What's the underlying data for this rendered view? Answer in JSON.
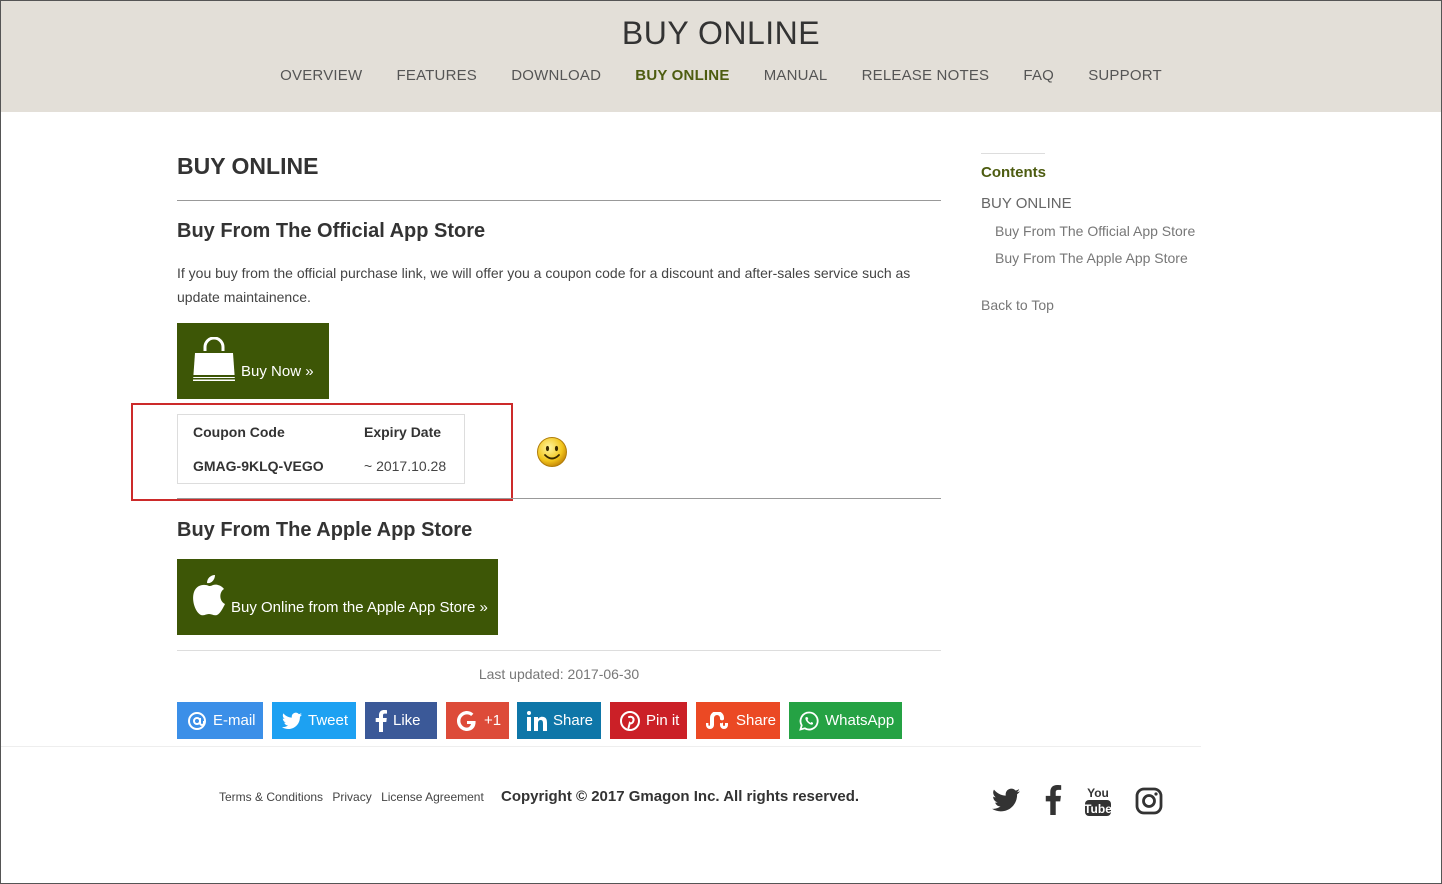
{
  "header": {
    "site_title": "BUY ONLINE",
    "nav": [
      "OVERVIEW",
      "FEATURES",
      "DOWNLOAD",
      "BUY ONLINE",
      "MANUAL",
      "RELEASE NOTES",
      "FAQ",
      "SUPPORT"
    ],
    "active": "BUY ONLINE"
  },
  "main": {
    "page_title": "BUY ONLINE",
    "section1_title": "Buy From The Official App Store",
    "section1_text": "If you buy from the official purchase link, we will offer you a coupon code for a discount and after-sales service such as update maintainence.",
    "buy_now_label": "Buy Now »",
    "coupon": {
      "col1_header": "Coupon Code",
      "col2_header": "Expiry Date",
      "code": "GMAG-9KLQ-VEGO",
      "expiry": "~ 2017.10.28"
    },
    "section2_title": "Buy From The Apple App Store",
    "apple_button_label": "Buy Online from the Apple App Store »",
    "last_updated": "Last updated: 2017-06-30"
  },
  "share": [
    {
      "label": "E-mail",
      "icon": "at-icon",
      "color": "#3b8fe8"
    },
    {
      "label": "Tweet",
      "icon": "twitter-icon",
      "color": "#1da1f2"
    },
    {
      "label": "Like",
      "icon": "facebook-icon",
      "color": "#3b5998"
    },
    {
      "label": "+1",
      "icon": "google-plus-icon",
      "color": "#dd4b39"
    },
    {
      "label": "Share",
      "icon": "linkedin-icon",
      "color": "#0e76a8"
    },
    {
      "label": "Pin it",
      "icon": "pinterest-icon",
      "color": "#cb2027"
    },
    {
      "label": "Share",
      "icon": "stumbleupon-icon",
      "color": "#eb4924"
    },
    {
      "label": "WhatsApp",
      "icon": "whatsapp-icon",
      "color": "#25a244"
    }
  ],
  "sidebar": {
    "heading": "Contents",
    "top_item": "BUY ONLINE",
    "sub_items": [
      "Buy From The Official App Store",
      "Buy From The Apple App Store"
    ],
    "back_to_top": "Back to Top"
  },
  "footer": {
    "links": [
      "Terms & Conditions",
      "Privacy",
      "License Agreement"
    ],
    "copyright": "Copyright © 2017 Gmagon Inc. All rights reserved.",
    "social": [
      "twitter-icon",
      "facebook-icon",
      "youtube-icon",
      "instagram-icon"
    ]
  },
  "colors": {
    "header_bg": "#e3dfd8",
    "accent": "#4d5c10",
    "button_bg": "#3d5606",
    "highlight": "#cc2a2a"
  }
}
